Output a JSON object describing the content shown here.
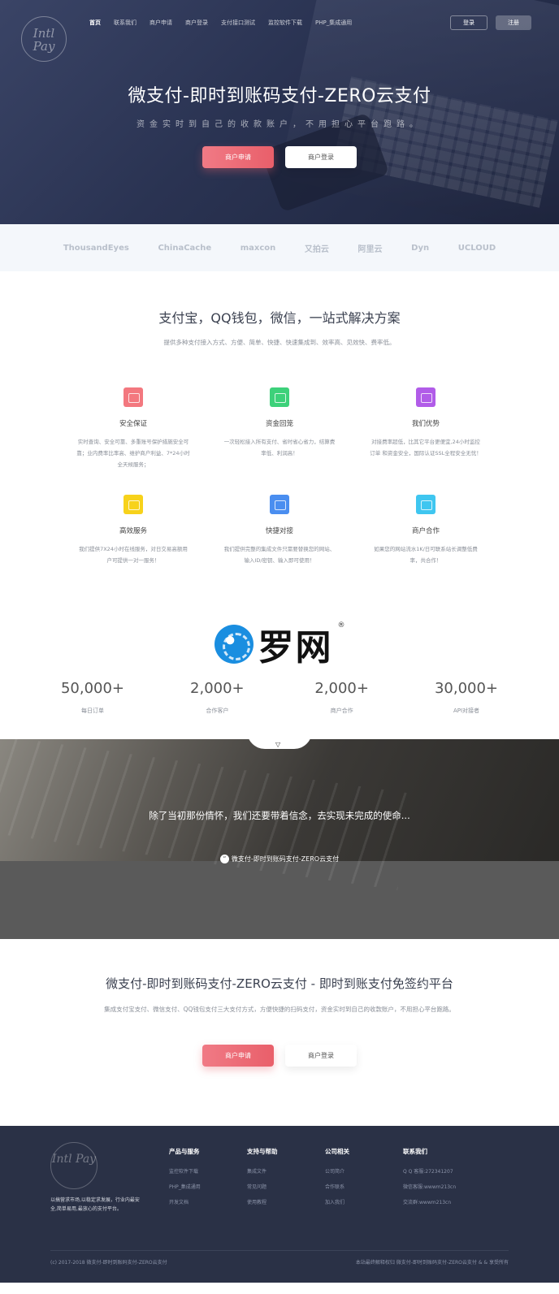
{
  "header": {
    "logo_text": "Intl Pay",
    "nav": [
      "首页",
      "联系我们",
      "商户申请",
      "商户登录",
      "支付接口测试",
      "监控软件下载",
      "PHP_集成通用"
    ],
    "login": "登录",
    "register": "注册"
  },
  "hero": {
    "title": "微支付-即时到账码支付-ZERO云支付",
    "subtitle": "资金实时到自己的收款账户，不用担心平台跑路。",
    "apply": "商户申请",
    "merchant_login": "商户登录"
  },
  "partners": [
    "ThousandEyes",
    "ChinaCache",
    "maxcon",
    "又拍云",
    "阿里云",
    "Dyn",
    "UCLOUD"
  ],
  "solution": {
    "title": "支付宝，QQ钱包，微信，一站式解决方案",
    "desc": "提供多种支付接入方式、方便、简单、快捷、快速集成到、效率高、见效快、费率低。",
    "features": [
      {
        "icon": "shield-icon",
        "color": "#f3787f",
        "title": "安全保证",
        "text": "实时查询、安全可靠、多重账号保护措施安全可靠；业内费率比率高、维护商户利益、7*24小时全天候服务；"
      },
      {
        "icon": "code-icon",
        "color": "#3dd17a",
        "title": "资金回笼",
        "text": "一次轻松接入所有支付、省时省心省力，结算费率低、利润高！"
      },
      {
        "icon": "star-icon",
        "color": "#b15ce8",
        "title": "我们优势",
        "text": "对接费率超低，比其它平台更便宜,24小时监控订单 和资金安全，国际认证SSL全程安全无忧！"
      },
      {
        "icon": "chart-icon",
        "color": "#f7d21b",
        "title": "高效服务",
        "text": "我们提供7X24小时在线服务，对日交易高额用户可提供一对一服务！"
      },
      {
        "icon": "pencil-icon",
        "color": "#4a8ef0",
        "title": "快捷对接",
        "text": "我们提供完整的集成文件只需要替换您的网站、输入ID/密钥、输入即可使用！"
      },
      {
        "icon": "move-icon",
        "color": "#3fc6f0",
        "title": "商户合作",
        "text": "如果您的网站流水1K/日可联系站长调整低费率，共合作！"
      }
    ]
  },
  "brand": {
    "name": "罗网",
    "reg": "®"
  },
  "stats": [
    {
      "num": "50,000+",
      "label": "每日订单"
    },
    {
      "num": "2,000+",
      "label": "合作客户"
    },
    {
      "num": "2,000+",
      "label": "商户合作"
    },
    {
      "num": "30,000+",
      "label": "API对接者"
    }
  ],
  "quote": {
    "text": "除了当初那份情怀，我们还要带着信念，去实现未完成的使命...",
    "author": "微支付-即时到账码支付-ZERO云支付"
  },
  "platform": {
    "title": "微支付-即时到账码支付-ZERO云支付 - 即时到账支付免签约平台",
    "desc": "集成支付宝支付、微信支付、QQ钱包支付三大支付方式，方便快捷的扫码支付，资金实时到自己的收款账户，不用担心平台跑路。",
    "apply": "商户申请",
    "merchant_login": "商户登录"
  },
  "footer": {
    "logo_text": "Intl Pay",
    "tagline": "以搞营求市场,以稳定求发展，行业内最安全,简单易用,最放心的支付平台。",
    "cols": [
      {
        "title": "产品与服务",
        "items": [
          "监控软件下载",
          "PHP_集成通用",
          "开发文档"
        ]
      },
      {
        "title": "支持与帮助",
        "items": [
          "集成文件",
          "常见问题",
          "使用教程"
        ]
      },
      {
        "title": "公司相关",
        "items": [
          "公司简介",
          "合作联系",
          "加入我们"
        ]
      },
      {
        "title": "联系我们",
        "items": [
          "Q Q 客服:272341207",
          "微信客服:wwwm213cn",
          "交流群:wwwm213cn"
        ]
      }
    ],
    "copyright": "(c) 2017-2018 微支付-即时到账码支付-ZERO云支付",
    "right_text": "本站最终解释权归 微支付-即时到账码支付-ZERO云支付 & & 享受所有"
  }
}
